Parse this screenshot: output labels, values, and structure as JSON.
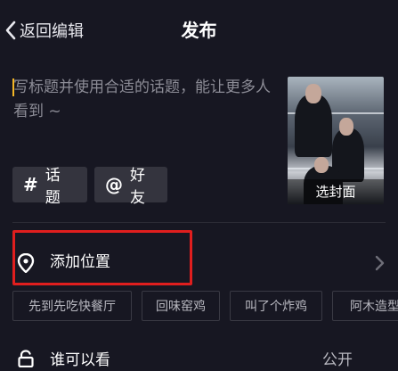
{
  "header": {
    "back_label": "返回编辑",
    "title": "发布"
  },
  "caption": {
    "placeholder": "写标题并使用合适的话题，能让更多人看到 ~"
  },
  "cover": {
    "label": "选封面"
  },
  "chips": [
    {
      "symbol": "#",
      "label": "话题"
    },
    {
      "symbol": "@",
      "label": "好友"
    }
  ],
  "location": {
    "label": "添加位置",
    "suggestions": [
      "先到先吃快餐厅",
      "回味窑鸡",
      "叫了个炸鸡",
      "阿木造型"
    ]
  },
  "visibility": {
    "label": "谁可以看",
    "value": "公开"
  },
  "colors": {
    "background": "#171722",
    "chip": "#34343e",
    "cursor": "#f3b626",
    "highlight": "#e01e1e"
  }
}
